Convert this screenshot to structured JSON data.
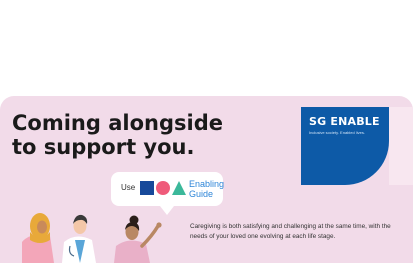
{
  "banner": {
    "headline": "Coming alongside\nto support you.",
    "body_text": "Caregiving is both satisfying and challenging at the same time, with the needs of your loved one evolving at each life stage.",
    "background_color": "#f2dbe9"
  },
  "brand": {
    "name": "SG ENABLE",
    "tagline": "Inclusive society. Enabled lives.",
    "color": "#0d5aa7"
  },
  "guide_bubble": {
    "use_label": "Use",
    "guide_label": "Enabling\nGuide",
    "icons": [
      "square-icon",
      "circle-icon",
      "triangle-icon"
    ],
    "colors": {
      "square": "#17499a",
      "circle": "#ef5b7a",
      "triangle": "#3bb89a",
      "guide_text": "#2f86d8"
    }
  },
  "illustration": {
    "icons": [
      "woman-hijab-figure",
      "doctor-figure",
      "woman-bun-figure"
    ]
  }
}
